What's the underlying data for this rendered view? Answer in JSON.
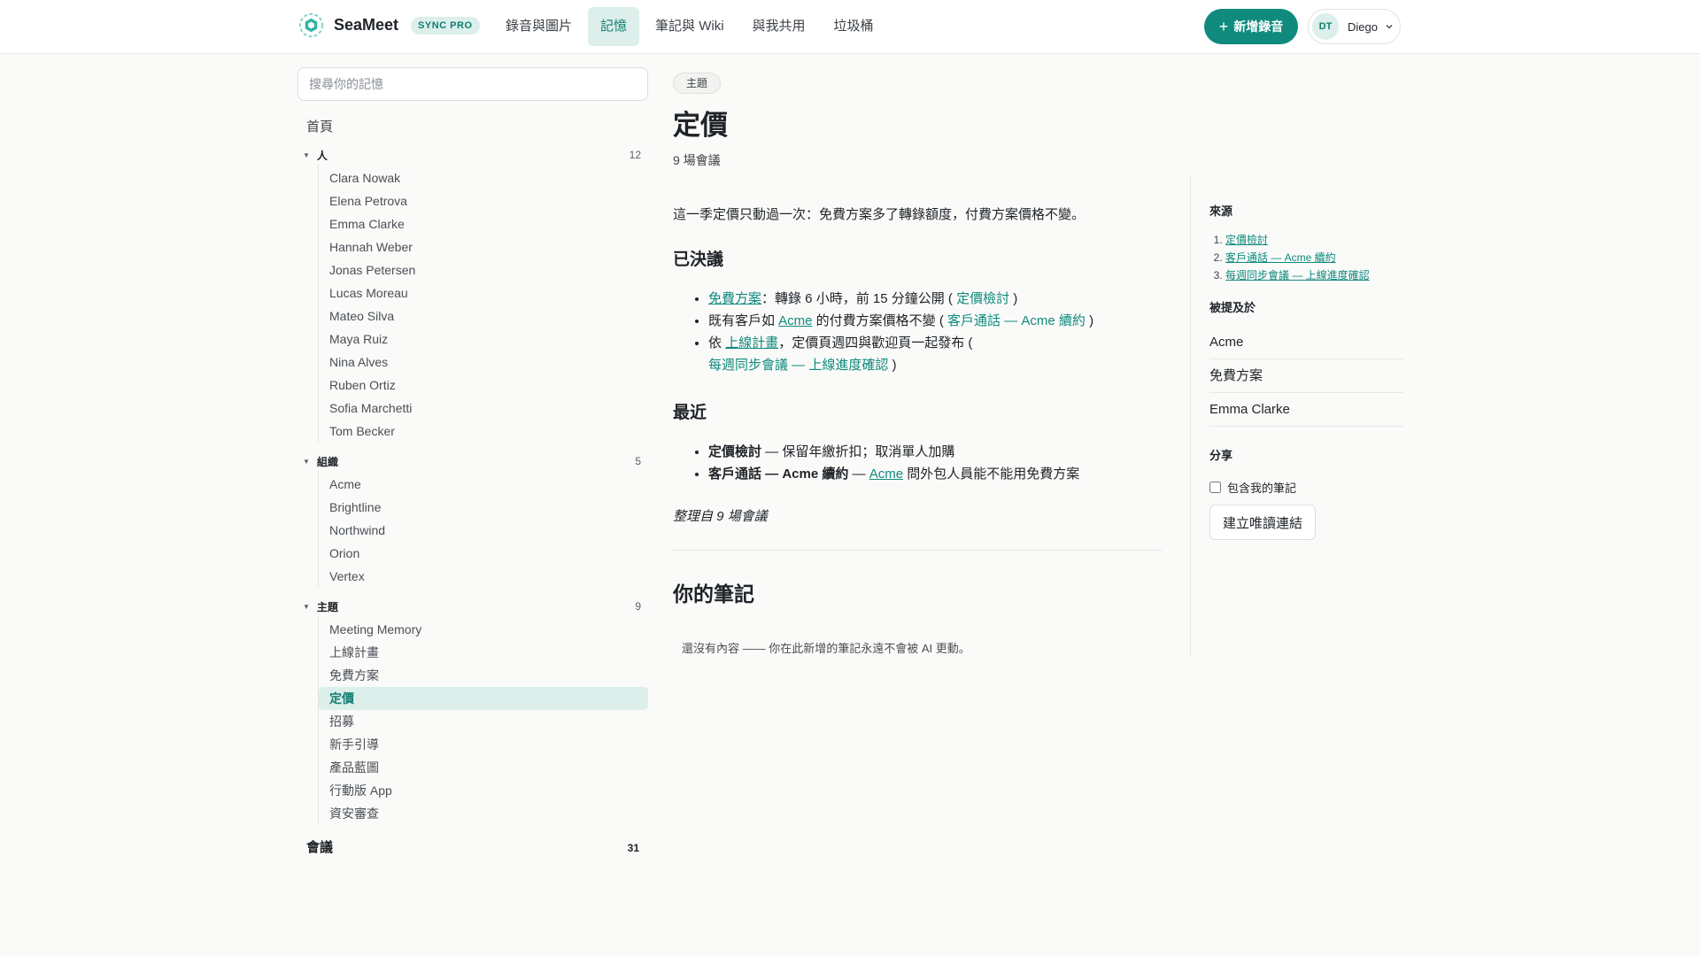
{
  "app": {
    "brand": "SeaMeet",
    "plan_badge": "SYNC PRO",
    "nav": [
      {
        "label": "錄音與圖片"
      },
      {
        "label": "記憶"
      },
      {
        "label": "筆記與 Wiki"
      },
      {
        "label": "與我共用"
      },
      {
        "label": "垃圾桶"
      }
    ],
    "new_recording": "新增錄音",
    "user": {
      "initials": "DT",
      "name": "Diego"
    },
    "accent": "#0f8a7c"
  },
  "sidebar": {
    "search_placeholder": "搜尋你的記憶",
    "home": "首頁",
    "people": {
      "title": "人",
      "count": "12",
      "items": [
        "Clara Nowak",
        "Elena Petrova",
        "Emma Clarke",
        "Hannah Weber",
        "Jonas Petersen",
        "Lucas Moreau",
        "Mateo Silva",
        "Maya Ruiz",
        "Nina Alves",
        "Ruben Ortiz",
        "Sofia Marchetti",
        "Tom Becker"
      ]
    },
    "orgs": {
      "title": "組織",
      "count": "5",
      "items": [
        "Acme",
        "Brightline",
        "Northwind",
        "Orion",
        "Vertex"
      ]
    },
    "topics": {
      "title": "主題",
      "count": "9",
      "items": [
        "Meeting Memory",
        "上線計畫",
        "免費方案",
        "定價",
        "招募",
        "新手引導",
        "產品藍圖",
        "行動版 App",
        "資安審查"
      ],
      "active": "定價"
    },
    "meetings": {
      "title": "會議",
      "count": "31"
    }
  },
  "main": {
    "tag": "主題",
    "title": "定價",
    "meta": "9 場會議",
    "summary": "這一季定價只動過一次：免費方案多了轉錄額度，付費方案價格不變。",
    "decided_heading": "已決議",
    "decided": [
      {
        "link": "免費方案",
        "text": "：轉錄 6 小時，前 15 分鐘公開",
        "cite": "定價檢討"
      },
      {
        "pre": "既有客戶如 ",
        "link": "Acme",
        "text": " 的付費方案價格不變",
        "cite": "客戶通話 — Acme 續約"
      },
      {
        "pre": "依 ",
        "link": "上線計畫",
        "text": "，定價頁週四與歡迎頁一起發布",
        "cite": "每週同步會議 — 上線進度確認"
      }
    ],
    "recent_heading": "最近",
    "recent": [
      {
        "bold": "定價檢討",
        "text": " — 保留年繳折扣；取消單人加購"
      },
      {
        "bold": "客戶通話 — Acme 續約",
        "sep": " — ",
        "link": "Acme",
        "text": " 問外包人員能不能用免費方案"
      }
    ],
    "footnote": "整理自 9 場會議",
    "notes_title": "你的筆記",
    "notes_empty": "還沒有內容 —— 你在此新增的筆記永遠不會被 AI 更動。"
  },
  "rail": {
    "sources_label": "來源",
    "sources": [
      "定價檢討",
      "客戶通話 — Acme 續約",
      "每週同步會議 — 上線進度確認"
    ],
    "mentioned_label": "被提及於",
    "mentioned": [
      "Acme",
      "免費方案",
      "Emma Clarke"
    ],
    "share_label": "分享",
    "include_notes": "包含我的筆記",
    "create_link": "建立唯讀連結"
  }
}
